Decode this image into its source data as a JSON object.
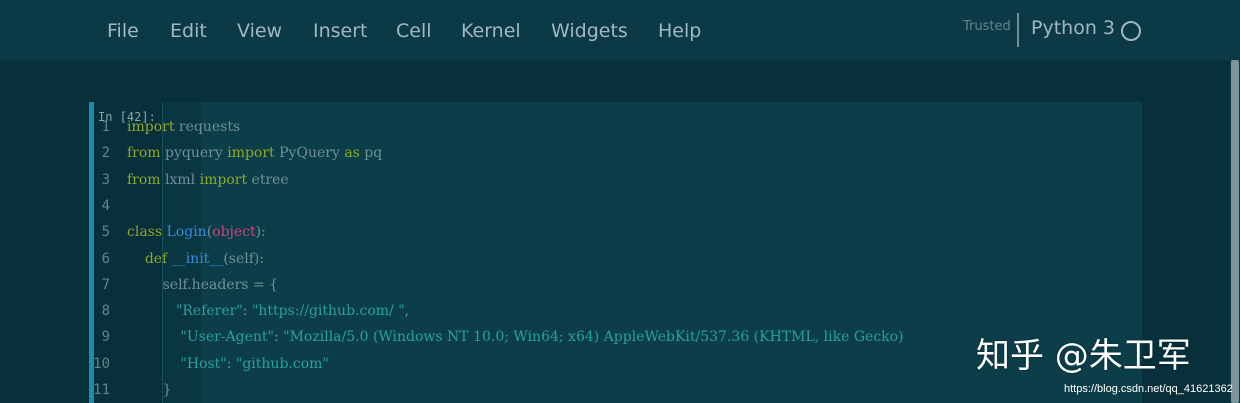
{
  "menu": {
    "items": [
      "File",
      "Edit",
      "View",
      "Insert",
      "Cell",
      "Kernel",
      "Widgets",
      "Help"
    ],
    "trusted_label": "Trusted",
    "kernel_name": "Python 3",
    "kernel_status_icon": "kernel-idle-circle-icon"
  },
  "cell": {
    "prompt": "In [42]:",
    "line_numbers": [
      "1",
      "2",
      "3",
      "4",
      "5",
      "6",
      "7",
      "8",
      "9",
      "10",
      "11"
    ],
    "lines": [
      [
        {
          "t": "import",
          "c": "kw"
        },
        {
          "t": " requests",
          "c": ""
        }
      ],
      [
        {
          "t": "from",
          "c": "kw"
        },
        {
          "t": " pyquery ",
          "c": ""
        },
        {
          "t": "import",
          "c": "kw"
        },
        {
          "t": " PyQuery ",
          "c": ""
        },
        {
          "t": "as",
          "c": "kw"
        },
        {
          "t": " pq",
          "c": ""
        }
      ],
      [
        {
          "t": "from",
          "c": "kw"
        },
        {
          "t": " lxml ",
          "c": ""
        },
        {
          "t": "import",
          "c": "kw"
        },
        {
          "t": " etree",
          "c": ""
        }
      ],
      [],
      [
        {
          "t": "class",
          "c": "kw"
        },
        {
          "t": " ",
          "c": ""
        },
        {
          "t": "Login",
          "c": "fn"
        },
        {
          "t": "(",
          "c": ""
        },
        {
          "t": "object",
          "c": "bi"
        },
        {
          "t": "):",
          "c": ""
        }
      ],
      [
        {
          "t": "    ",
          "c": ""
        },
        {
          "t": "def",
          "c": "kw"
        },
        {
          "t": " ",
          "c": ""
        },
        {
          "t": "__init__",
          "c": "fn"
        },
        {
          "t": "(self):",
          "c": ""
        }
      ],
      [
        {
          "t": "        self.headers = {",
          "c": ""
        }
      ],
      [
        {
          "t": "           ",
          "c": ""
        },
        {
          "t": "\"Referer\"",
          "c": "str"
        },
        {
          "t": ": ",
          "c": ""
        },
        {
          "t": "\"https://github.com/ \"",
          "c": "str"
        },
        {
          "t": ",",
          "c": ""
        }
      ],
      [
        {
          "t": "            ",
          "c": ""
        },
        {
          "t": "\"User-Agent\"",
          "c": "str"
        },
        {
          "t": ": ",
          "c": ""
        },
        {
          "t": "\"Mozilla/5.0 (Windows NT 10.0; Win64; x64) AppleWebKit/537.36 (KHTML, like Gecko)",
          "c": "str"
        }
      ],
      [
        {
          "t": "            ",
          "c": ""
        },
        {
          "t": "\"Host\"",
          "c": "str"
        },
        {
          "t": ": ",
          "c": ""
        },
        {
          "t": "\"github.com\"",
          "c": "str"
        }
      ],
      [
        {
          "t": "        }",
          "c": ""
        }
      ]
    ]
  },
  "watermark": {
    "text": "知乎 @朱卫军",
    "url": "https://blog.csdn.net/qq_41621362"
  },
  "colors": {
    "background": "#07303a",
    "menubar": "#0b3a46",
    "cell_accent": "#1e8ea3",
    "keyword": "#8fa82b",
    "function": "#2f8ed6",
    "builtin": "#d1437a",
    "string": "#2aa198"
  }
}
